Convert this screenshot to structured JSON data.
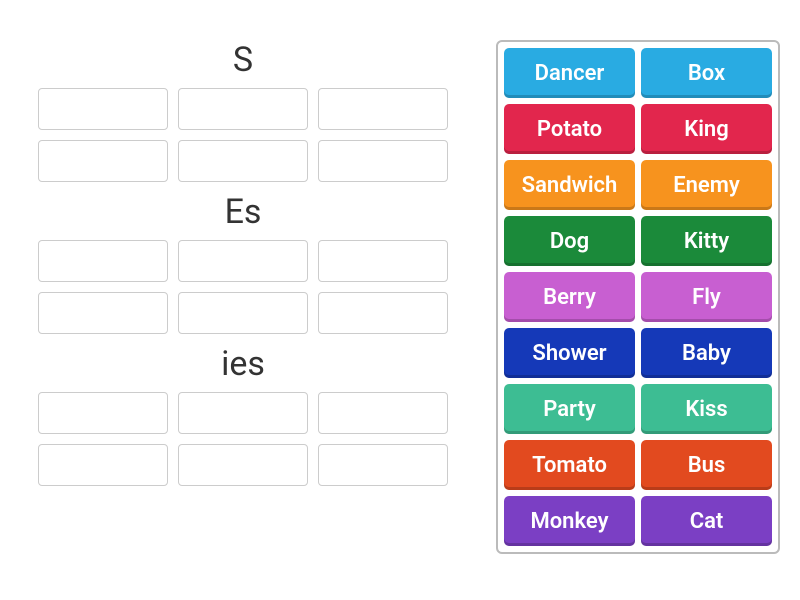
{
  "groups": [
    {
      "title": "S",
      "slots": 6
    },
    {
      "title": "Es",
      "slots": 6
    },
    {
      "title": "ies",
      "slots": 6
    }
  ],
  "word_bank": [
    {
      "label": "Dancer",
      "color": "#29abe2"
    },
    {
      "label": "Box",
      "color": "#29abe2"
    },
    {
      "label": "Potato",
      "color": "#e2264d"
    },
    {
      "label": "King",
      "color": "#e2264d"
    },
    {
      "label": "Sandwich",
      "color": "#f7931e"
    },
    {
      "label": "Enemy",
      "color": "#f7931e"
    },
    {
      "label": "Dog",
      "color": "#1b8a3a"
    },
    {
      "label": "Kitty",
      "color": "#1b8a3a"
    },
    {
      "label": "Berry",
      "color": "#c85fd1"
    },
    {
      "label": "Fly",
      "color": "#c85fd1"
    },
    {
      "label": "Shower",
      "color": "#1539b8"
    },
    {
      "label": "Baby",
      "color": "#1539b8"
    },
    {
      "label": "Party",
      "color": "#3dbd93"
    },
    {
      "label": "Kiss",
      "color": "#3dbd93"
    },
    {
      "label": "Tomato",
      "color": "#e24a1f"
    },
    {
      "label": "Bus",
      "color": "#e24a1f"
    },
    {
      "label": "Monkey",
      "color": "#7b3fc4"
    },
    {
      "label": "Cat",
      "color": "#7b3fc4"
    }
  ]
}
